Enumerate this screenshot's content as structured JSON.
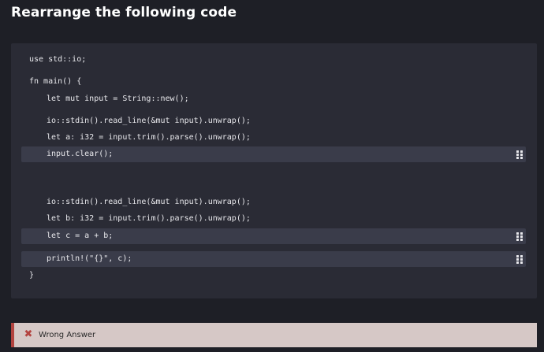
{
  "page": {
    "title": "Rearrange the following code"
  },
  "code": {
    "lines": [
      {
        "text": "use std::io;",
        "indent": false,
        "movable": false
      },
      {
        "text": "fn main() {",
        "indent": false,
        "movable": false
      },
      {
        "text": "let mut input = String::new();",
        "indent": true,
        "movable": false
      },
      {
        "text": "io::stdin().read_line(&mut input).unwrap();",
        "indent": true,
        "movable": false
      },
      {
        "text": "let a: i32 = input.trim().parse().unwrap();",
        "indent": true,
        "movable": false
      },
      {
        "text": "input.clear();",
        "indent": true,
        "movable": true
      },
      {
        "text": "io::stdin().read_line(&mut input).unwrap();",
        "indent": true,
        "movable": false
      },
      {
        "text": "let b: i32 = input.trim().parse().unwrap();",
        "indent": true,
        "movable": false
      },
      {
        "text": "let c = a + b;",
        "indent": true,
        "movable": true
      },
      {
        "text": "println!(\"{}\", c);",
        "indent": true,
        "movable": true
      },
      {
        "text": "}",
        "indent": false,
        "movable": false
      }
    ],
    "drag_icon": "drag-handle-icon"
  },
  "result": {
    "icon": "close-icon",
    "icon_glyph": "✖",
    "message": "Wrong Answer",
    "accent_color": "#b3433f",
    "background_color": "#d6c8c6"
  }
}
